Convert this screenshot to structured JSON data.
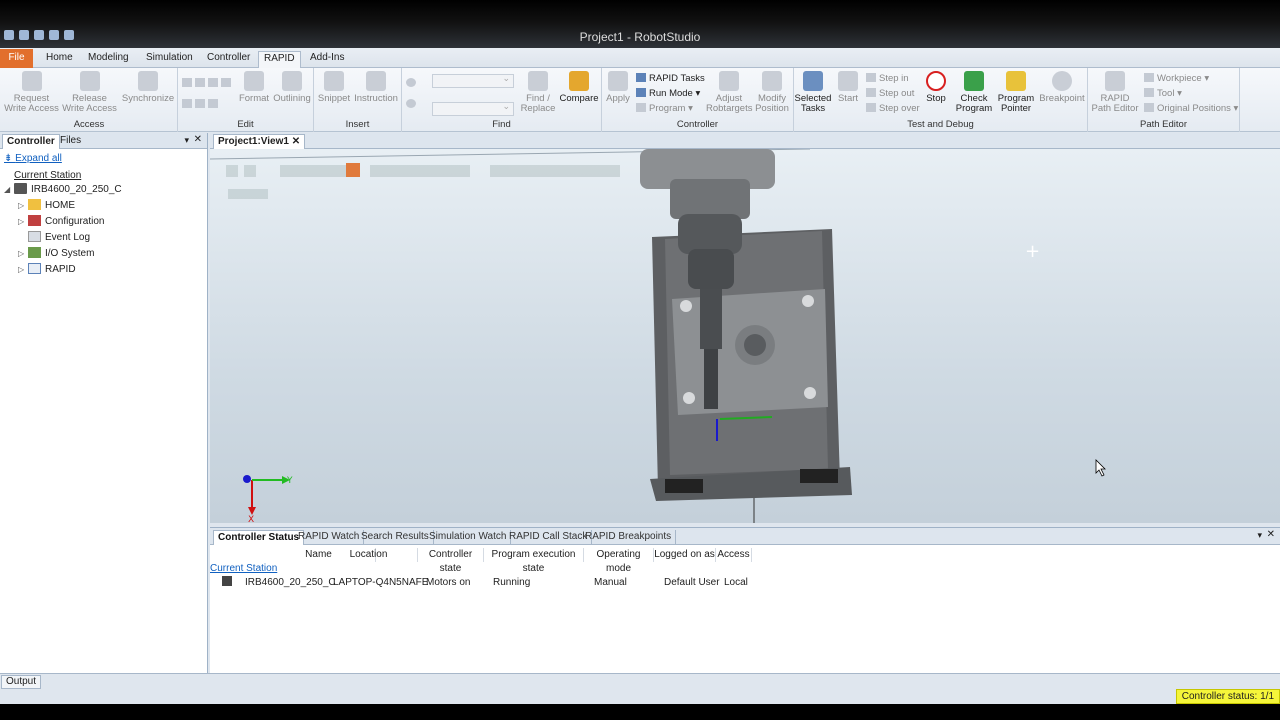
{
  "window": {
    "title": "Project1 - RobotStudio"
  },
  "tabs": [
    "File",
    "Home",
    "Modeling",
    "Simulation",
    "Controller",
    "RAPID",
    "Add-Ins"
  ],
  "ribbon": {
    "access": {
      "label": "Access",
      "request": "Request\nWrite Access",
      "release": "Release\nWrite Access"
    },
    "sync": "Synchronize",
    "edit": {
      "label": "Edit",
      "format": "Format",
      "outlining": "Outlining"
    },
    "insert": {
      "label": "Insert",
      "snippet": "Snippet",
      "instruction": "Instruction"
    },
    "find": {
      "label": "Find",
      "findreplace": "Find /\nReplace",
      "compare": "Compare"
    },
    "controller": {
      "label": "Controller",
      "apply": "Apply",
      "rapid_tasks": "RAPID Tasks",
      "run_mode": "Run Mode",
      "program": "Program",
      "adjust": "Adjust\nRobtargets",
      "modify": "Modify\nPosition"
    },
    "testdebug": {
      "label": "Test and Debug",
      "selected_tasks": "Selected\nTasks",
      "start": "Start",
      "step_in": "Step in",
      "step_out": "Step out",
      "step_over": "Step over",
      "stop": "Stop",
      "check": "Check\nProgram",
      "pointer": "Program\nPointer",
      "breakpoint": "Breakpoint"
    },
    "patheditor": {
      "label": "Path Editor",
      "rapid_path": "RAPID\nPath Editor",
      "workpiece": "Workpiece",
      "tool": "Tool",
      "original": "Original Positions"
    }
  },
  "left_panel": {
    "tabs": [
      "Controller",
      "Files"
    ],
    "expand_all": "Expand all",
    "current_station": "Current Station",
    "controller_name": "IRB4600_20_250_C",
    "items": [
      "HOME",
      "Configuration",
      "Event Log",
      "I/O System",
      "RAPID"
    ]
  },
  "view": {
    "tab": "Project1:View1",
    "axis_x": "X",
    "axis_y": "Y"
  },
  "bottom": {
    "tabs": [
      "Controller Status",
      "RAPID Watch",
      "Search Results",
      "Simulation Watch",
      "RAPID Call Stack",
      "RAPID Breakpoints"
    ],
    "columns": [
      "Name",
      "Location",
      "Controller state",
      "Program execution state",
      "Operating mode",
      "Logged on as",
      "Access"
    ],
    "group": "Current Station",
    "row": {
      "name": "IRB4600_20_250_C",
      "location": "LAPTOP-Q4N5NAFE",
      "state": "Motors on",
      "exec": "Running",
      "mode": "Manual",
      "user": "Default User",
      "access": "Local"
    }
  },
  "output_tab": "Output",
  "controller_status": "Controller status: 1/1",
  "colors": {
    "file_tab": "#e26f2c",
    "status_highlight": "#f5f53a",
    "link": "#1060c0"
  }
}
